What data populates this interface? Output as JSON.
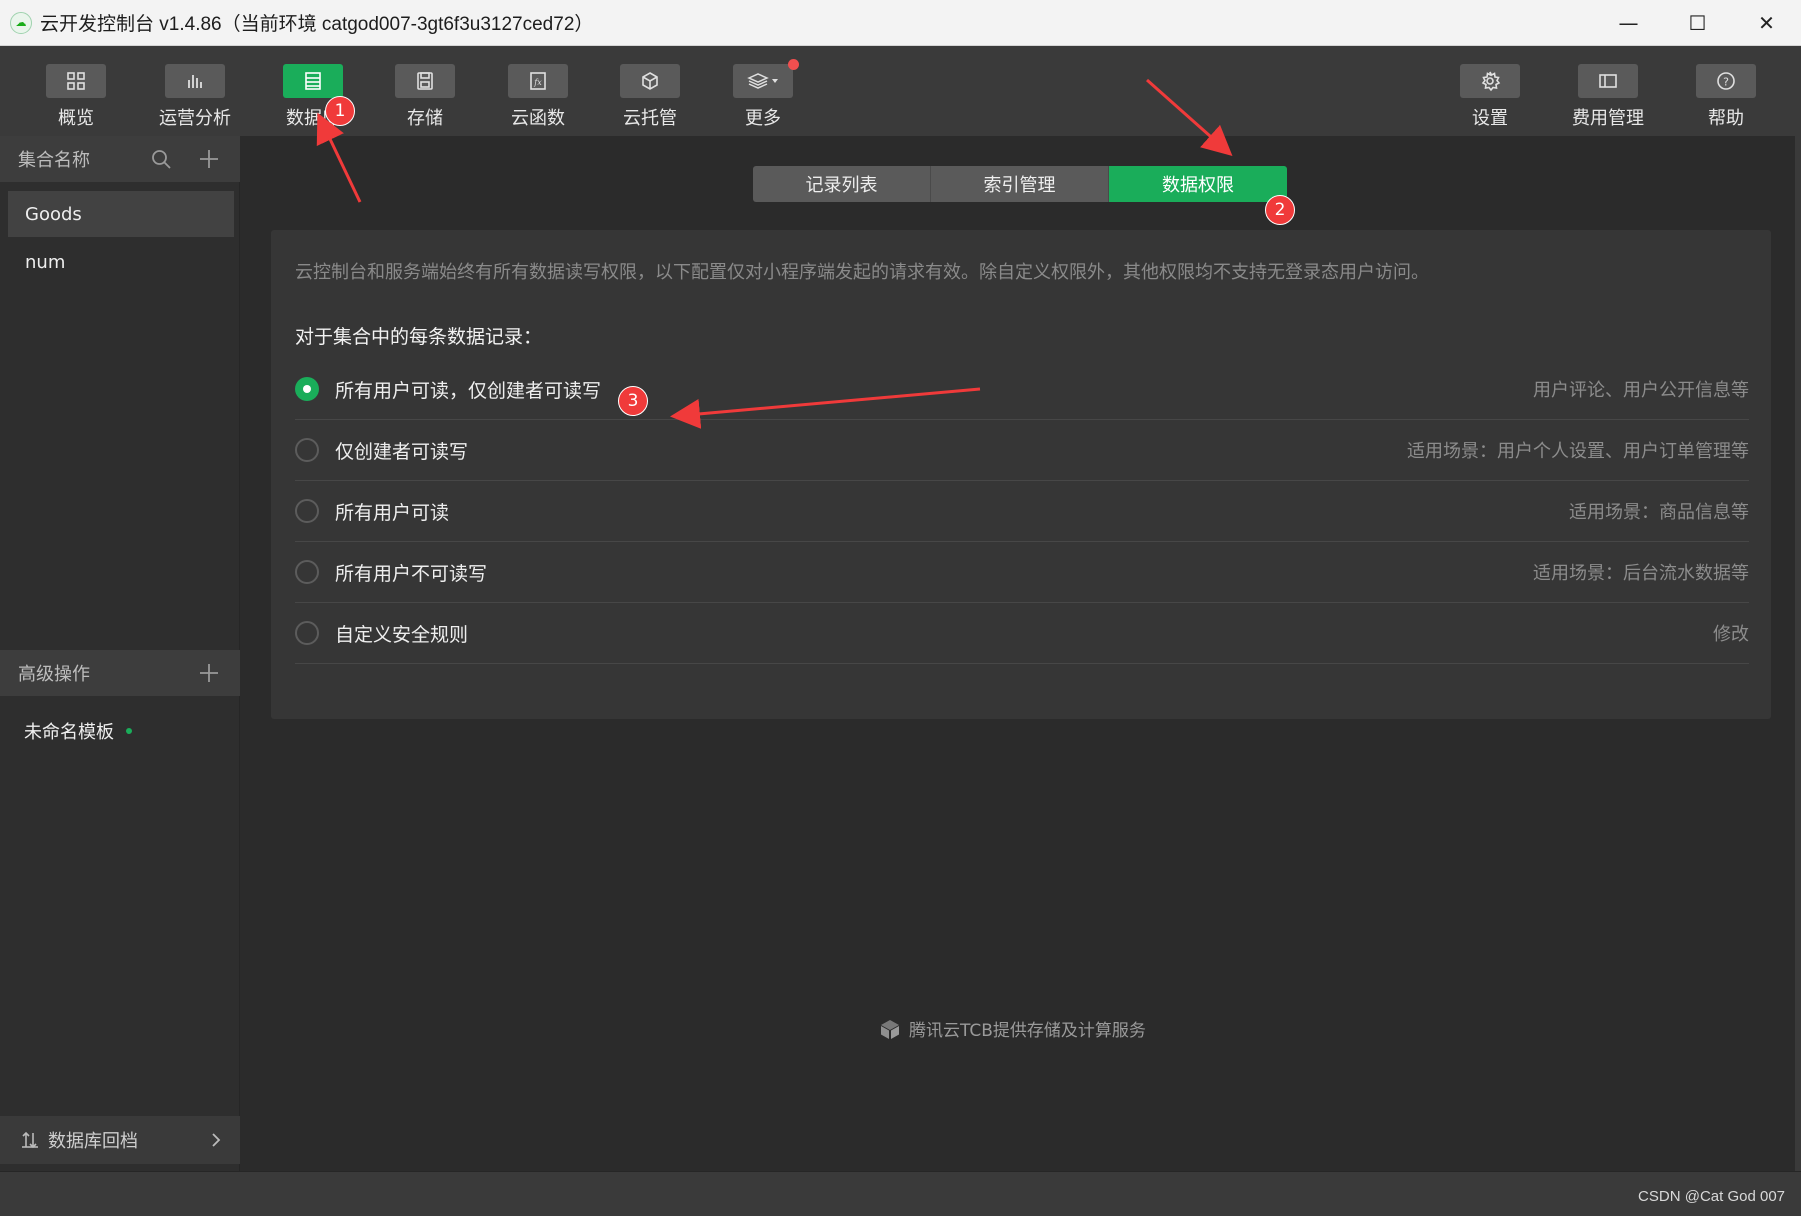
{
  "window": {
    "title": "云开发控制台 v1.4.86（当前环境 catgod007-3gt6f3u3127ced72）",
    "controls": {
      "minimize": "—",
      "maximize": "☐",
      "close": "✕"
    }
  },
  "toolbar": {
    "left": [
      {
        "label": "概览",
        "icon": "grid-icon"
      },
      {
        "label": "运营分析",
        "icon": "bar-chart-icon"
      },
      {
        "label": "数据库",
        "icon": "database-icon",
        "active": true
      },
      {
        "label": "存储",
        "icon": "save-icon"
      },
      {
        "label": "云函数",
        "icon": "function-icon"
      },
      {
        "label": "云托管",
        "icon": "cube-icon"
      },
      {
        "label": "更多",
        "icon": "layers-icon"
      }
    ],
    "right": [
      {
        "label": "设置",
        "icon": "gear-icon"
      },
      {
        "label": "费用管理",
        "icon": "billing-icon"
      },
      {
        "label": "帮助",
        "icon": "help-icon"
      }
    ]
  },
  "sidebar": {
    "collections_header": "集合名称",
    "collections": [
      "Goods",
      "num"
    ],
    "selected_collection": "Goods",
    "advanced_header": "高级操作",
    "templates": [
      "未命名模板"
    ],
    "footer": "数据库回档"
  },
  "tabs": [
    "记录列表",
    "索引管理",
    "数据权限"
  ],
  "active_tab": "数据权限",
  "permissions": {
    "notice": "云控制台和服务端始终有所有数据读写权限，以下配置仅对小程序端发起的请求有效。除自定义权限外，其他权限均不支持无登录态用户访问。",
    "subtitle": "对于集合中的每条数据记录：",
    "options": [
      {
        "label": "所有用户可读，仅创建者可读写",
        "hint": "用户评论、用户公开信息等",
        "checked": true
      },
      {
        "label": "仅创建者可读写",
        "hint": "适用场景：用户个人设置、用户订单管理等",
        "checked": false
      },
      {
        "label": "所有用户可读",
        "hint": "适用场景：商品信息等",
        "checked": false
      },
      {
        "label": "所有用户不可读写",
        "hint": "适用场景：后台流水数据等",
        "checked": false
      },
      {
        "label": "自定义安全规则",
        "hint": "修改",
        "checked": false
      }
    ]
  },
  "powered_by": "腾讯云TCB提供存储及计算服务",
  "watermark": "CSDN @Cat God 007",
  "annotations": [
    "1",
    "2",
    "3"
  ],
  "colors": {
    "accent": "#1aad5a",
    "annotation": "#f03a3a"
  }
}
